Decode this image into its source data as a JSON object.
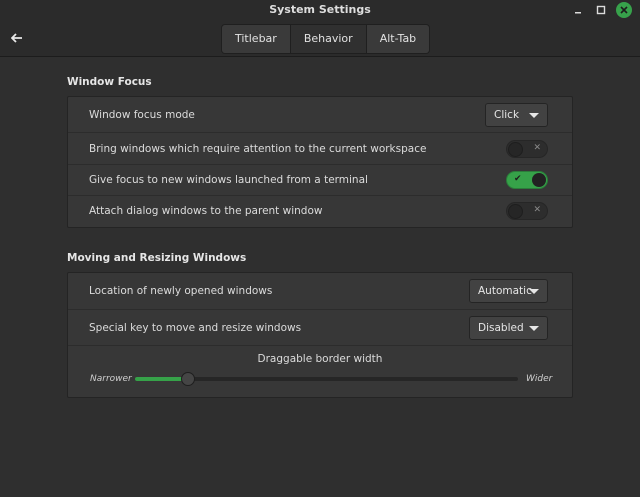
{
  "window": {
    "title": "System Settings"
  },
  "tabs": [
    {
      "label": "Titlebar",
      "active": false
    },
    {
      "label": "Behavior",
      "active": true
    },
    {
      "label": "Alt-Tab",
      "active": false
    }
  ],
  "window_focus": {
    "title": "Window Focus",
    "focus_mode": {
      "label": "Window focus mode",
      "value": "Click"
    },
    "bring_attention": {
      "label": "Bring windows which require attention to the current workspace",
      "on": false
    },
    "focus_terminal": {
      "label": "Give focus to new windows launched from a terminal",
      "on": true
    },
    "attach_dialog": {
      "label": "Attach dialog windows to the parent window",
      "on": false
    }
  },
  "moving_resizing": {
    "title": "Moving and Resizing Windows",
    "location": {
      "label": "Location of newly opened windows",
      "value": "Automatic"
    },
    "special_key": {
      "label": "Special key to move and resize windows",
      "value": "Disabled"
    },
    "border_width": {
      "label": "Draggable border width",
      "min_label": "Narrower",
      "max_label": "Wider",
      "fraction": 0.135
    }
  },
  "colors": {
    "accent": "#36a249",
    "close_button": "#37a24b"
  },
  "icons": {
    "back": "back-arrow-icon",
    "minimize": "minimize-icon",
    "maximize": "maximize-icon",
    "close": "close-icon"
  }
}
